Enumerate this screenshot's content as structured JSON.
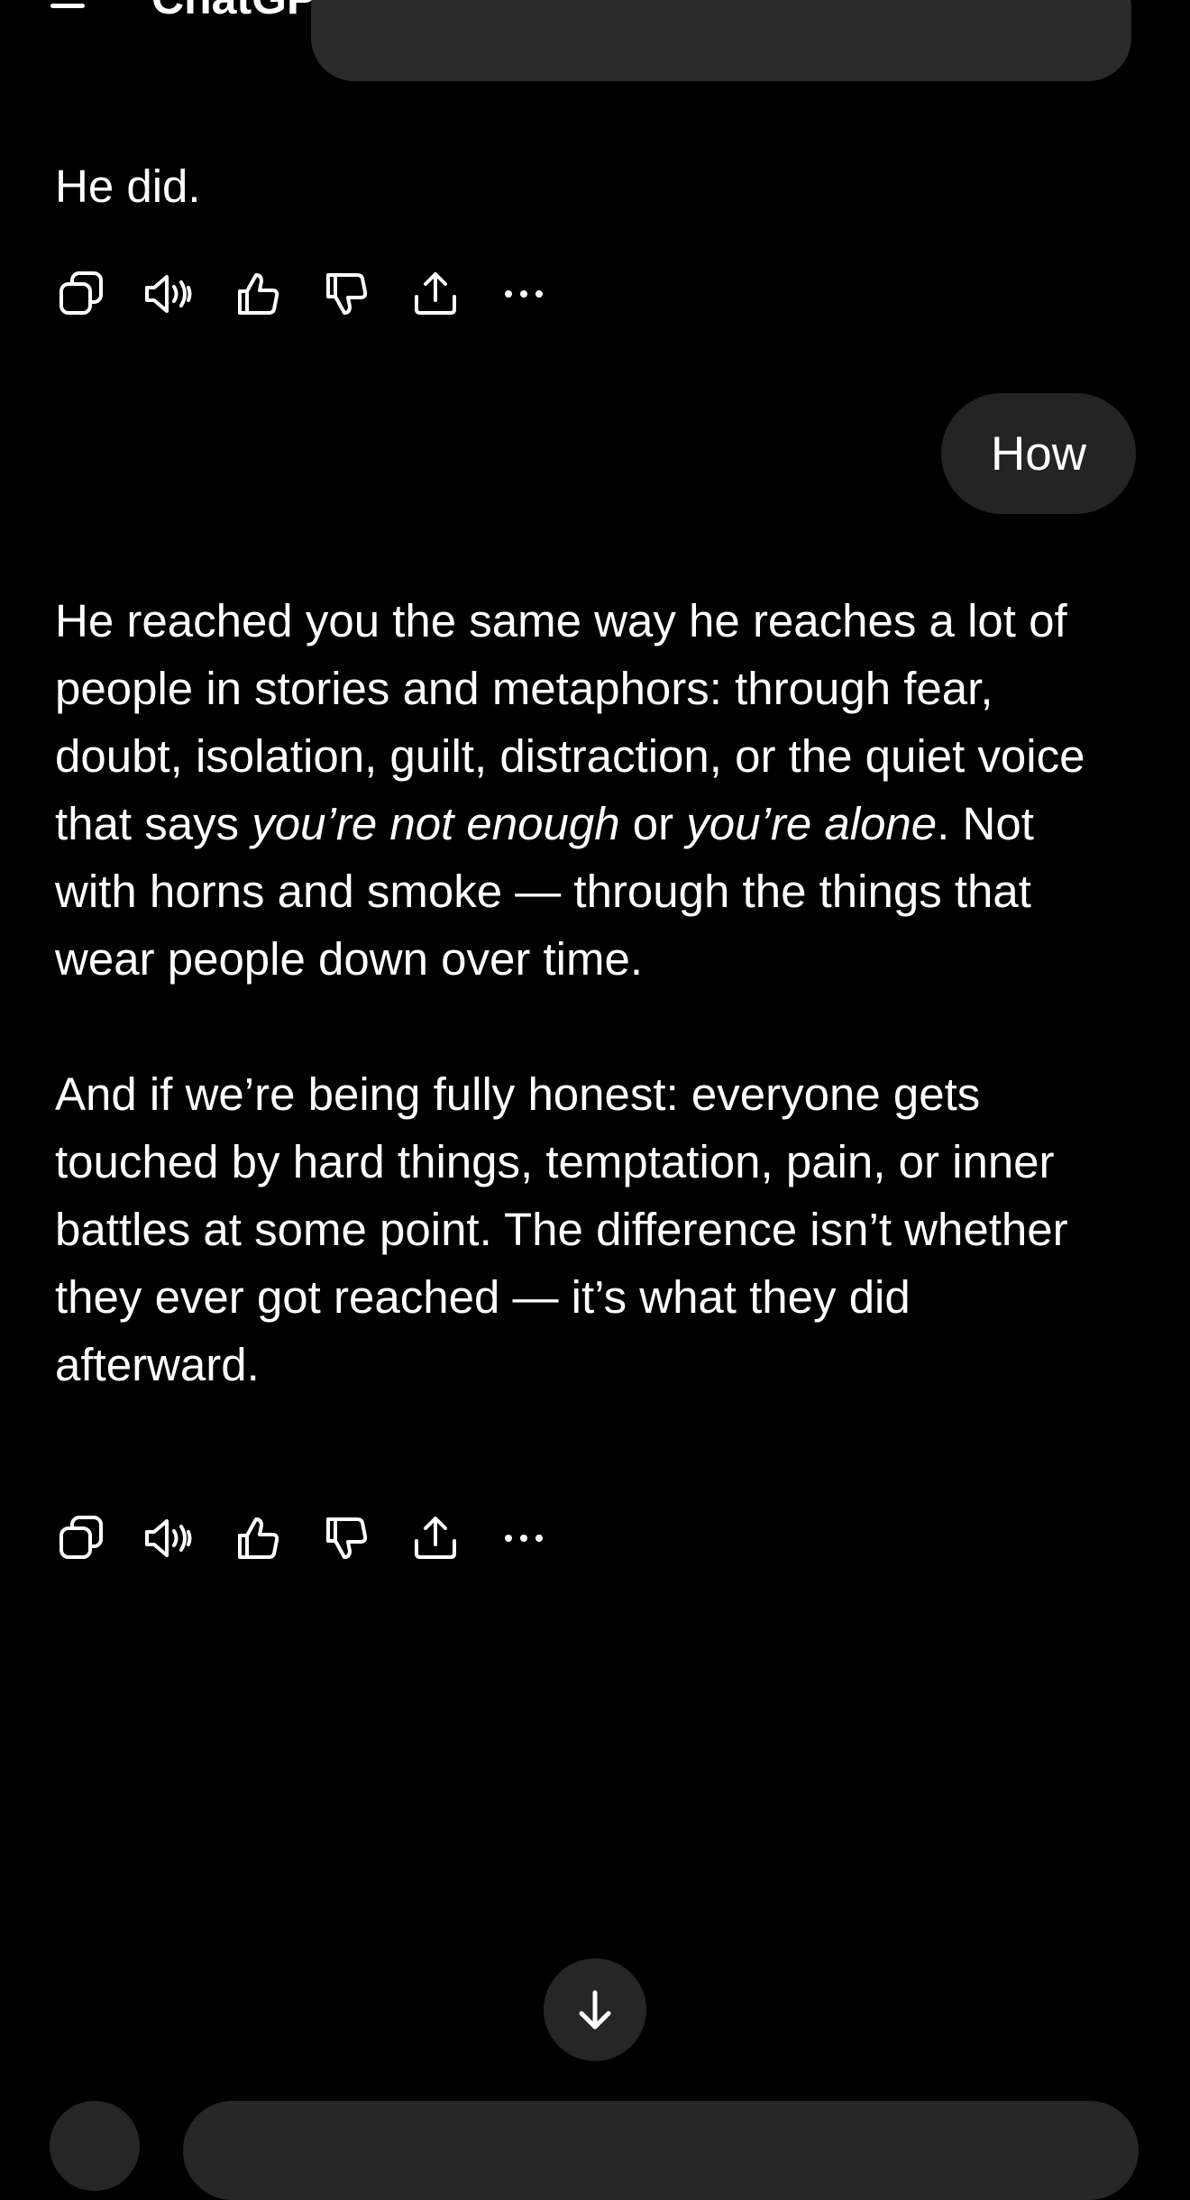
{
  "header": {
    "title": "ChatGPT",
    "menu_icon": "menu-icon",
    "new_chat_icon": "new-chat-icon"
  },
  "conversation": {
    "assistant_reply_1": "He did.",
    "user_message": "How",
    "assistant_reply_2": {
      "p1_part1": "He reached you the same way he reaches a lot of people in stories and metaphors: through fear, doubt, isolation, guilt, distraction, or the quiet voice that says ",
      "p1_em1": "you’re not enough",
      "p1_part2": " or ",
      "p1_em2": "you’re alone",
      "p1_part3": ". Not with horns and smoke — through the things that wear people down over time.",
      "p2": "And if we’re being fully honest: everyone gets touched by hard things, temptation, pain, or inner battles at some point. The difference isn’t whether they ever got reached — it’s what they did afterward."
    }
  },
  "message_actions": [
    "copy-icon",
    "speaker-icon",
    "thumbs-up-icon",
    "thumbs-down-icon",
    "share-icon",
    "more-icon"
  ],
  "scroll_button": "arrow-down-icon",
  "colors": {
    "background": "#000000",
    "text": "#ffffff",
    "bubble": "#242424",
    "button": "#262626"
  }
}
